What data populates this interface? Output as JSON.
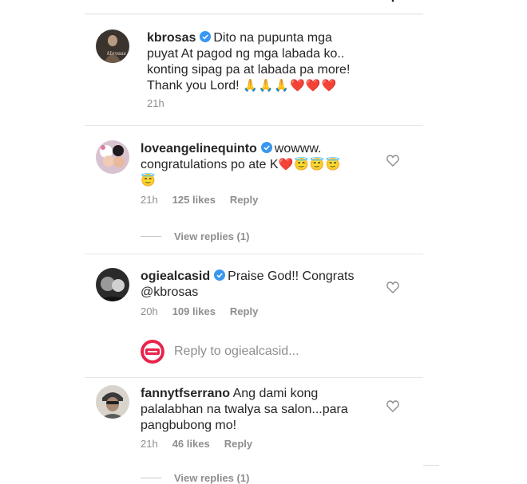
{
  "caption": {
    "username": "kbrosas",
    "lines": [
      "Dito na pupunta mga",
      "puyat At pagod ng mga labada ko..",
      "konting sipag pa at labada pa more!",
      "Thank you Lord!"
    ],
    "emoji": "🙏🙏🙏❤️❤️❤️",
    "time": "21h"
  },
  "comments": [
    {
      "username": "loveangelinequinto",
      "text_line1": "wowww.",
      "text_line2": "congratulations po ate K",
      "emoji_line2": "❤️😇😇😇",
      "emoji_line3": "😇",
      "time": "21h",
      "likes": "125 likes",
      "reply": "Reply",
      "view_replies": "View replies (1)"
    },
    {
      "username": "ogiealcasid",
      "text_line1": "Praise God!! Congrats",
      "text_line2": "@kbrosas",
      "time": "20h",
      "likes": "109 likes",
      "reply": "Reply"
    },
    {
      "username": "fannytfserrano",
      "text_line1": "Ang dami kong",
      "text_line2": "palalabhan na twalya sa salon...para",
      "text_line3": "pangbubong mo!",
      "time": "21h",
      "likes": "46 likes",
      "reply": "Reply",
      "view_replies": "View replies (1)"
    }
  ],
  "reply_box": {
    "placeholder": "Reply to ogiealcasid..."
  },
  "colors": {
    "verified": "#3897f0",
    "muted": "#8e8e8e",
    "text": "#262626",
    "pep_logo": "#e8234b"
  }
}
